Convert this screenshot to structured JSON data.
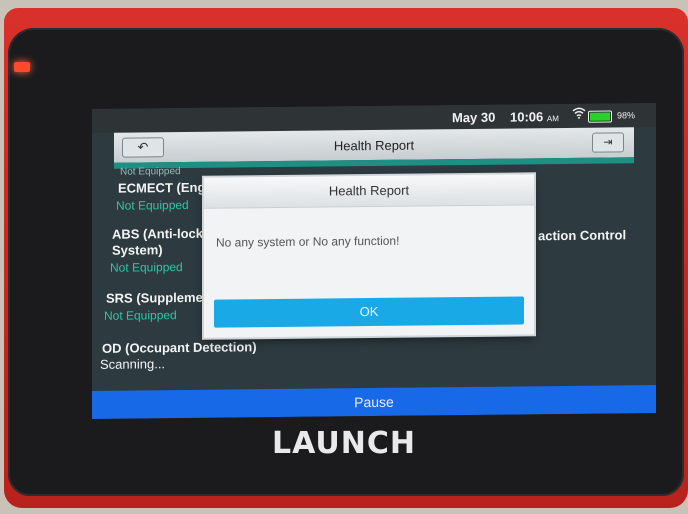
{
  "statusbar": {
    "date": "May 30",
    "time": "10:06",
    "ampm": "AM",
    "battery": "98%",
    "battery_level": 0.98,
    "icons": [
      "wifi-icon",
      "battery-icon"
    ]
  },
  "header": {
    "title": "Health Report",
    "back_icon": "back-arrow-icon",
    "exit_icon": "exit-icon"
  },
  "systems": [
    {
      "name": "ECMECT (Engine",
      "status": "Not Equipped"
    },
    {
      "name": "ABS (Anti-lock B",
      "name2": "System)",
      "status": "Not Equipped"
    },
    {
      "name": "SRS (Supplemen",
      "status": "Not Equipped"
    },
    {
      "name": "OD (Occupant Detection)",
      "status": "Scanning..."
    }
  ],
  "right_column": {
    "partial_label": "action Control"
  },
  "top_partial_status": "Not Equipped",
  "dialog": {
    "title": "Health Report",
    "message": "No any system or No any function!",
    "ok_label": "OK"
  },
  "footer": {
    "pause_label": "Pause"
  },
  "device": {
    "brand": "LAUNCH"
  },
  "colors": {
    "case_red": "#c52620",
    "status_teal": "#2ec5a6",
    "ok_blue": "#19a9e6",
    "pause_blue": "#1769e8"
  }
}
